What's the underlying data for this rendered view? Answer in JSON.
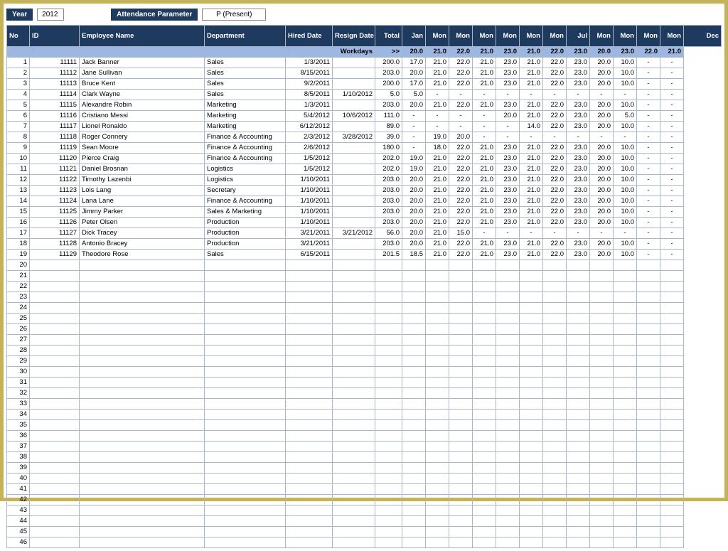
{
  "top": {
    "year_label": "Year",
    "year_value": "2012",
    "attendance_label": "Attendance Parameter",
    "attendance_value": "P (Present)"
  },
  "headers": [
    "No",
    "ID",
    "Employee Name",
    "Department",
    "Hired Date",
    "Resign Date",
    "Total",
    "Jan",
    "Mon",
    "Mon",
    "Mon",
    "Mon",
    "Mon",
    "Mon",
    "Jul",
    "Mon",
    "Mon",
    "Mon",
    "Mon",
    "Dec"
  ],
  "workdays_row": {
    "label": "Workdays",
    "arrow": ">>",
    "values": [
      "20.0",
      "21.0",
      "22.0",
      "21.0",
      "23.0",
      "21.0",
      "22.0",
      "23.0",
      "20.0",
      "23.0",
      "22.0",
      "21.0"
    ]
  },
  "rows": [
    {
      "no": "1",
      "id": "11111",
      "name": "Jack Banner",
      "dept": "Sales",
      "hired": "1/3/2011",
      "resign": "",
      "total": "200.0",
      "m": [
        "17.0",
        "21.0",
        "22.0",
        "21.0",
        "23.0",
        "21.0",
        "22.0",
        "23.0",
        "20.0",
        "10.0",
        "-",
        "-"
      ]
    },
    {
      "no": "2",
      "id": "11112",
      "name": "Jane Sullivan",
      "dept": "Sales",
      "hired": "8/15/2011",
      "resign": "",
      "total": "203.0",
      "m": [
        "20.0",
        "21.0",
        "22.0",
        "21.0",
        "23.0",
        "21.0",
        "22.0",
        "23.0",
        "20.0",
        "10.0",
        "-",
        "-"
      ]
    },
    {
      "no": "3",
      "id": "11113",
      "name": "Bruce Kent",
      "dept": "Sales",
      "hired": "9/2/2011",
      "resign": "",
      "total": "200.0",
      "m": [
        "17.0",
        "21.0",
        "22.0",
        "21.0",
        "23.0",
        "21.0",
        "22.0",
        "23.0",
        "20.0",
        "10.0",
        "-",
        "-"
      ]
    },
    {
      "no": "4",
      "id": "11114",
      "name": "Clark Wayne",
      "dept": "Sales",
      "hired": "8/5/2011",
      "resign": "1/10/2012",
      "total": "5.0",
      "m": [
        "5.0",
        "-",
        "-",
        "-",
        "-",
        "-",
        "-",
        "-",
        "-",
        "-",
        "-",
        "-"
      ]
    },
    {
      "no": "5",
      "id": "11115",
      "name": "Alexandre Robin",
      "dept": "Marketing",
      "hired": "1/3/2011",
      "resign": "",
      "total": "203.0",
      "m": [
        "20.0",
        "21.0",
        "22.0",
        "21.0",
        "23.0",
        "21.0",
        "22.0",
        "23.0",
        "20.0",
        "10.0",
        "-",
        "-"
      ]
    },
    {
      "no": "6",
      "id": "11116",
      "name": "Cristiano Messi",
      "dept": "Marketing",
      "hired": "5/4/2012",
      "resign": "10/6/2012",
      "total": "111.0",
      "m": [
        "-",
        "-",
        "-",
        "-",
        "20.0",
        "21.0",
        "22.0",
        "23.0",
        "20.0",
        "5.0",
        "-",
        "-"
      ]
    },
    {
      "no": "7",
      "id": "11117",
      "name": "Lionel Ronaldo",
      "dept": "Marketing",
      "hired": "6/12/2012",
      "resign": "",
      "total": "89.0",
      "m": [
        "-",
        "-",
        "-",
        "-",
        "-",
        "14.0",
        "22.0",
        "23.0",
        "20.0",
        "10.0",
        "-",
        "-"
      ]
    },
    {
      "no": "8",
      "id": "11118",
      "name": "Roger Connery",
      "dept": "Finance & Accounting",
      "hired": "2/3/2012",
      "resign": "3/28/2012",
      "total": "39.0",
      "m": [
        "-",
        "19.0",
        "20.0",
        "-",
        "-",
        "-",
        "-",
        "-",
        "-",
        "-",
        "-",
        "-"
      ]
    },
    {
      "no": "9",
      "id": "11119",
      "name": "Sean Moore",
      "dept": "Finance & Accounting",
      "hired": "2/6/2012",
      "resign": "",
      "total": "180.0",
      "m": [
        "-",
        "18.0",
        "22.0",
        "21.0",
        "23.0",
        "21.0",
        "22.0",
        "23.0",
        "20.0",
        "10.0",
        "-",
        "-"
      ]
    },
    {
      "no": "10",
      "id": "11120",
      "name": "Pierce Craig",
      "dept": "Finance & Accounting",
      "hired": "1/5/2012",
      "resign": "",
      "total": "202.0",
      "m": [
        "19.0",
        "21.0",
        "22.0",
        "21.0",
        "23.0",
        "21.0",
        "22.0",
        "23.0",
        "20.0",
        "10.0",
        "-",
        "-"
      ]
    },
    {
      "no": "11",
      "id": "11121",
      "name": "Daniel Brosnan",
      "dept": "Logistics",
      "hired": "1/5/2012",
      "resign": "",
      "total": "202.0",
      "m": [
        "19.0",
        "21.0",
        "22.0",
        "21.0",
        "23.0",
        "21.0",
        "22.0",
        "23.0",
        "20.0",
        "10.0",
        "-",
        "-"
      ]
    },
    {
      "no": "12",
      "id": "11122",
      "name": "Timothy Lazenbi",
      "dept": "Logistics",
      "hired": "1/10/2011",
      "resign": "",
      "total": "203.0",
      "m": [
        "20.0",
        "21.0",
        "22.0",
        "21.0",
        "23.0",
        "21.0",
        "22.0",
        "23.0",
        "20.0",
        "10.0",
        "-",
        "-"
      ]
    },
    {
      "no": "13",
      "id": "11123",
      "name": "Lois Lang",
      "dept": "Secretary",
      "hired": "1/10/2011",
      "resign": "",
      "total": "203.0",
      "m": [
        "20.0",
        "21.0",
        "22.0",
        "21.0",
        "23.0",
        "21.0",
        "22.0",
        "23.0",
        "20.0",
        "10.0",
        "-",
        "-"
      ]
    },
    {
      "no": "14",
      "id": "11124",
      "name": "Lana Lane",
      "dept": "Finance & Accounting",
      "hired": "1/10/2011",
      "resign": "",
      "total": "203.0",
      "m": [
        "20.0",
        "21.0",
        "22.0",
        "21.0",
        "23.0",
        "21.0",
        "22.0",
        "23.0",
        "20.0",
        "10.0",
        "-",
        "-"
      ]
    },
    {
      "no": "15",
      "id": "11125",
      "name": "Jimmy Parker",
      "dept": "Sales & Marketing",
      "hired": "1/10/2011",
      "resign": "",
      "total": "203.0",
      "m": [
        "20.0",
        "21.0",
        "22.0",
        "21.0",
        "23.0",
        "21.0",
        "22.0",
        "23.0",
        "20.0",
        "10.0",
        "-",
        "-"
      ]
    },
    {
      "no": "16",
      "id": "11126",
      "name": "Peter Olsen",
      "dept": "Production",
      "hired": "1/10/2011",
      "resign": "",
      "total": "203.0",
      "m": [
        "20.0",
        "21.0",
        "22.0",
        "21.0",
        "23.0",
        "21.0",
        "22.0",
        "23.0",
        "20.0",
        "10.0",
        "-",
        "-"
      ]
    },
    {
      "no": "17",
      "id": "11127",
      "name": "Dick Tracey",
      "dept": "Production",
      "hired": "3/21/2011",
      "resign": "3/21/2012",
      "total": "56.0",
      "m": [
        "20.0",
        "21.0",
        "15.0",
        "-",
        "-",
        "-",
        "-",
        "-",
        "-",
        "-",
        "-",
        "-"
      ]
    },
    {
      "no": "18",
      "id": "11128",
      "name": "Antonio Bracey",
      "dept": "Production",
      "hired": "3/21/2011",
      "resign": "",
      "total": "203.0",
      "m": [
        "20.0",
        "21.0",
        "22.0",
        "21.0",
        "23.0",
        "21.0",
        "22.0",
        "23.0",
        "20.0",
        "10.0",
        "-",
        "-"
      ]
    },
    {
      "no": "19",
      "id": "11129",
      "name": "Theodore Rose",
      "dept": "Sales",
      "hired": "6/15/2011",
      "resign": "",
      "total": "201.5",
      "m": [
        "18.5",
        "21.0",
        "22.0",
        "21.0",
        "23.0",
        "21.0",
        "22.0",
        "23.0",
        "20.0",
        "10.0",
        "-",
        "-"
      ]
    }
  ],
  "empty_rows_start": 20,
  "empty_rows_end": 46
}
